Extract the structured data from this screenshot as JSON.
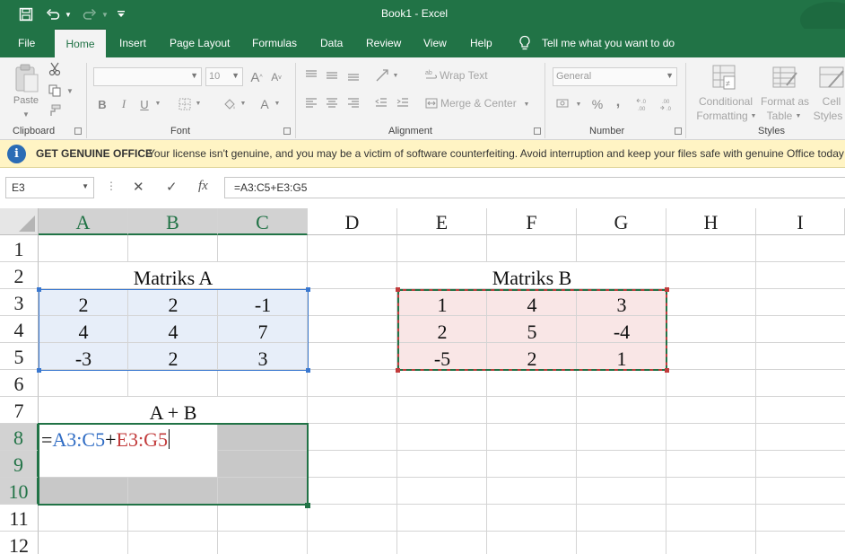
{
  "window": {
    "title": "Book1  -  Excel"
  },
  "qat": {
    "save": "save-icon",
    "undo": "undo-icon",
    "redo": "redo-icon",
    "customize": "customize-icon"
  },
  "tabs": [
    "File",
    "Home",
    "Insert",
    "Page Layout",
    "Formulas",
    "Data",
    "Review",
    "View",
    "Help"
  ],
  "tell_me": "Tell me what you want to do",
  "ribbon": {
    "paste_label": "Paste",
    "font_name": "",
    "font_size": "10",
    "wrap_text": "Wrap Text",
    "merge_center": "Merge & Center",
    "number_format": "General",
    "conditional_formatting": [
      "Conditional",
      "Formatting"
    ],
    "format_as_table": [
      "Format as",
      "Table"
    ],
    "cell_styles": [
      "Cell",
      "Styles"
    ],
    "groups": [
      "Clipboard",
      "Font",
      "Alignment",
      "Number",
      "Styles"
    ],
    "bold": "B",
    "italic": "I",
    "underline": "U",
    "font_color": "A",
    "percent": "%",
    "comma": ",",
    "grow_font": "A",
    "shrink_font": "A"
  },
  "notice": {
    "heading": "GET GENUINE OFFICE",
    "message": "Your license isn't genuine, and you may be a victim of software counterfeiting. Avoid interruption and keep your files safe with genuine Office today"
  },
  "formula_bar": {
    "name_box": "E3",
    "cancel": "✕",
    "enter": "✓",
    "fx": "fx",
    "formula": "=A3:C5+E3:G5"
  },
  "grid": {
    "columns": [
      "A",
      "B",
      "C",
      "D",
      "E",
      "F",
      "G",
      "H",
      "I"
    ],
    "rows": [
      "1",
      "2",
      "3",
      "4",
      "5",
      "6",
      "7",
      "8",
      "9",
      "10",
      "11",
      "12"
    ],
    "titles": {
      "matrix_a": "Matriks A",
      "matrix_b": "Matriks B",
      "sum": "A + B"
    },
    "matrix_a": [
      [
        "2",
        "2",
        "-1"
      ],
      [
        "4",
        "4",
        "7"
      ],
      [
        "-3",
        "2",
        "3"
      ]
    ],
    "matrix_b": [
      [
        "1",
        "4",
        "3"
      ],
      [
        "2",
        "5",
        "-4"
      ],
      [
        "-5",
        "2",
        "1"
      ]
    ],
    "editing": {
      "eq": "=",
      "ref_a": "A3:C5",
      "plus": "+",
      "ref_b": "E3:G5"
    }
  },
  "colors": {
    "excel_green": "#217346",
    "range_a_fill": "#e7eef9",
    "range_a_border": "#3a78d0",
    "range_b_fill": "#f9e6e6",
    "range_b_border": "#c23b3b",
    "ref_a_text": "#2f6cc4",
    "ref_b_text": "#c23b3b",
    "selection_fill": "#c8c8c8"
  }
}
